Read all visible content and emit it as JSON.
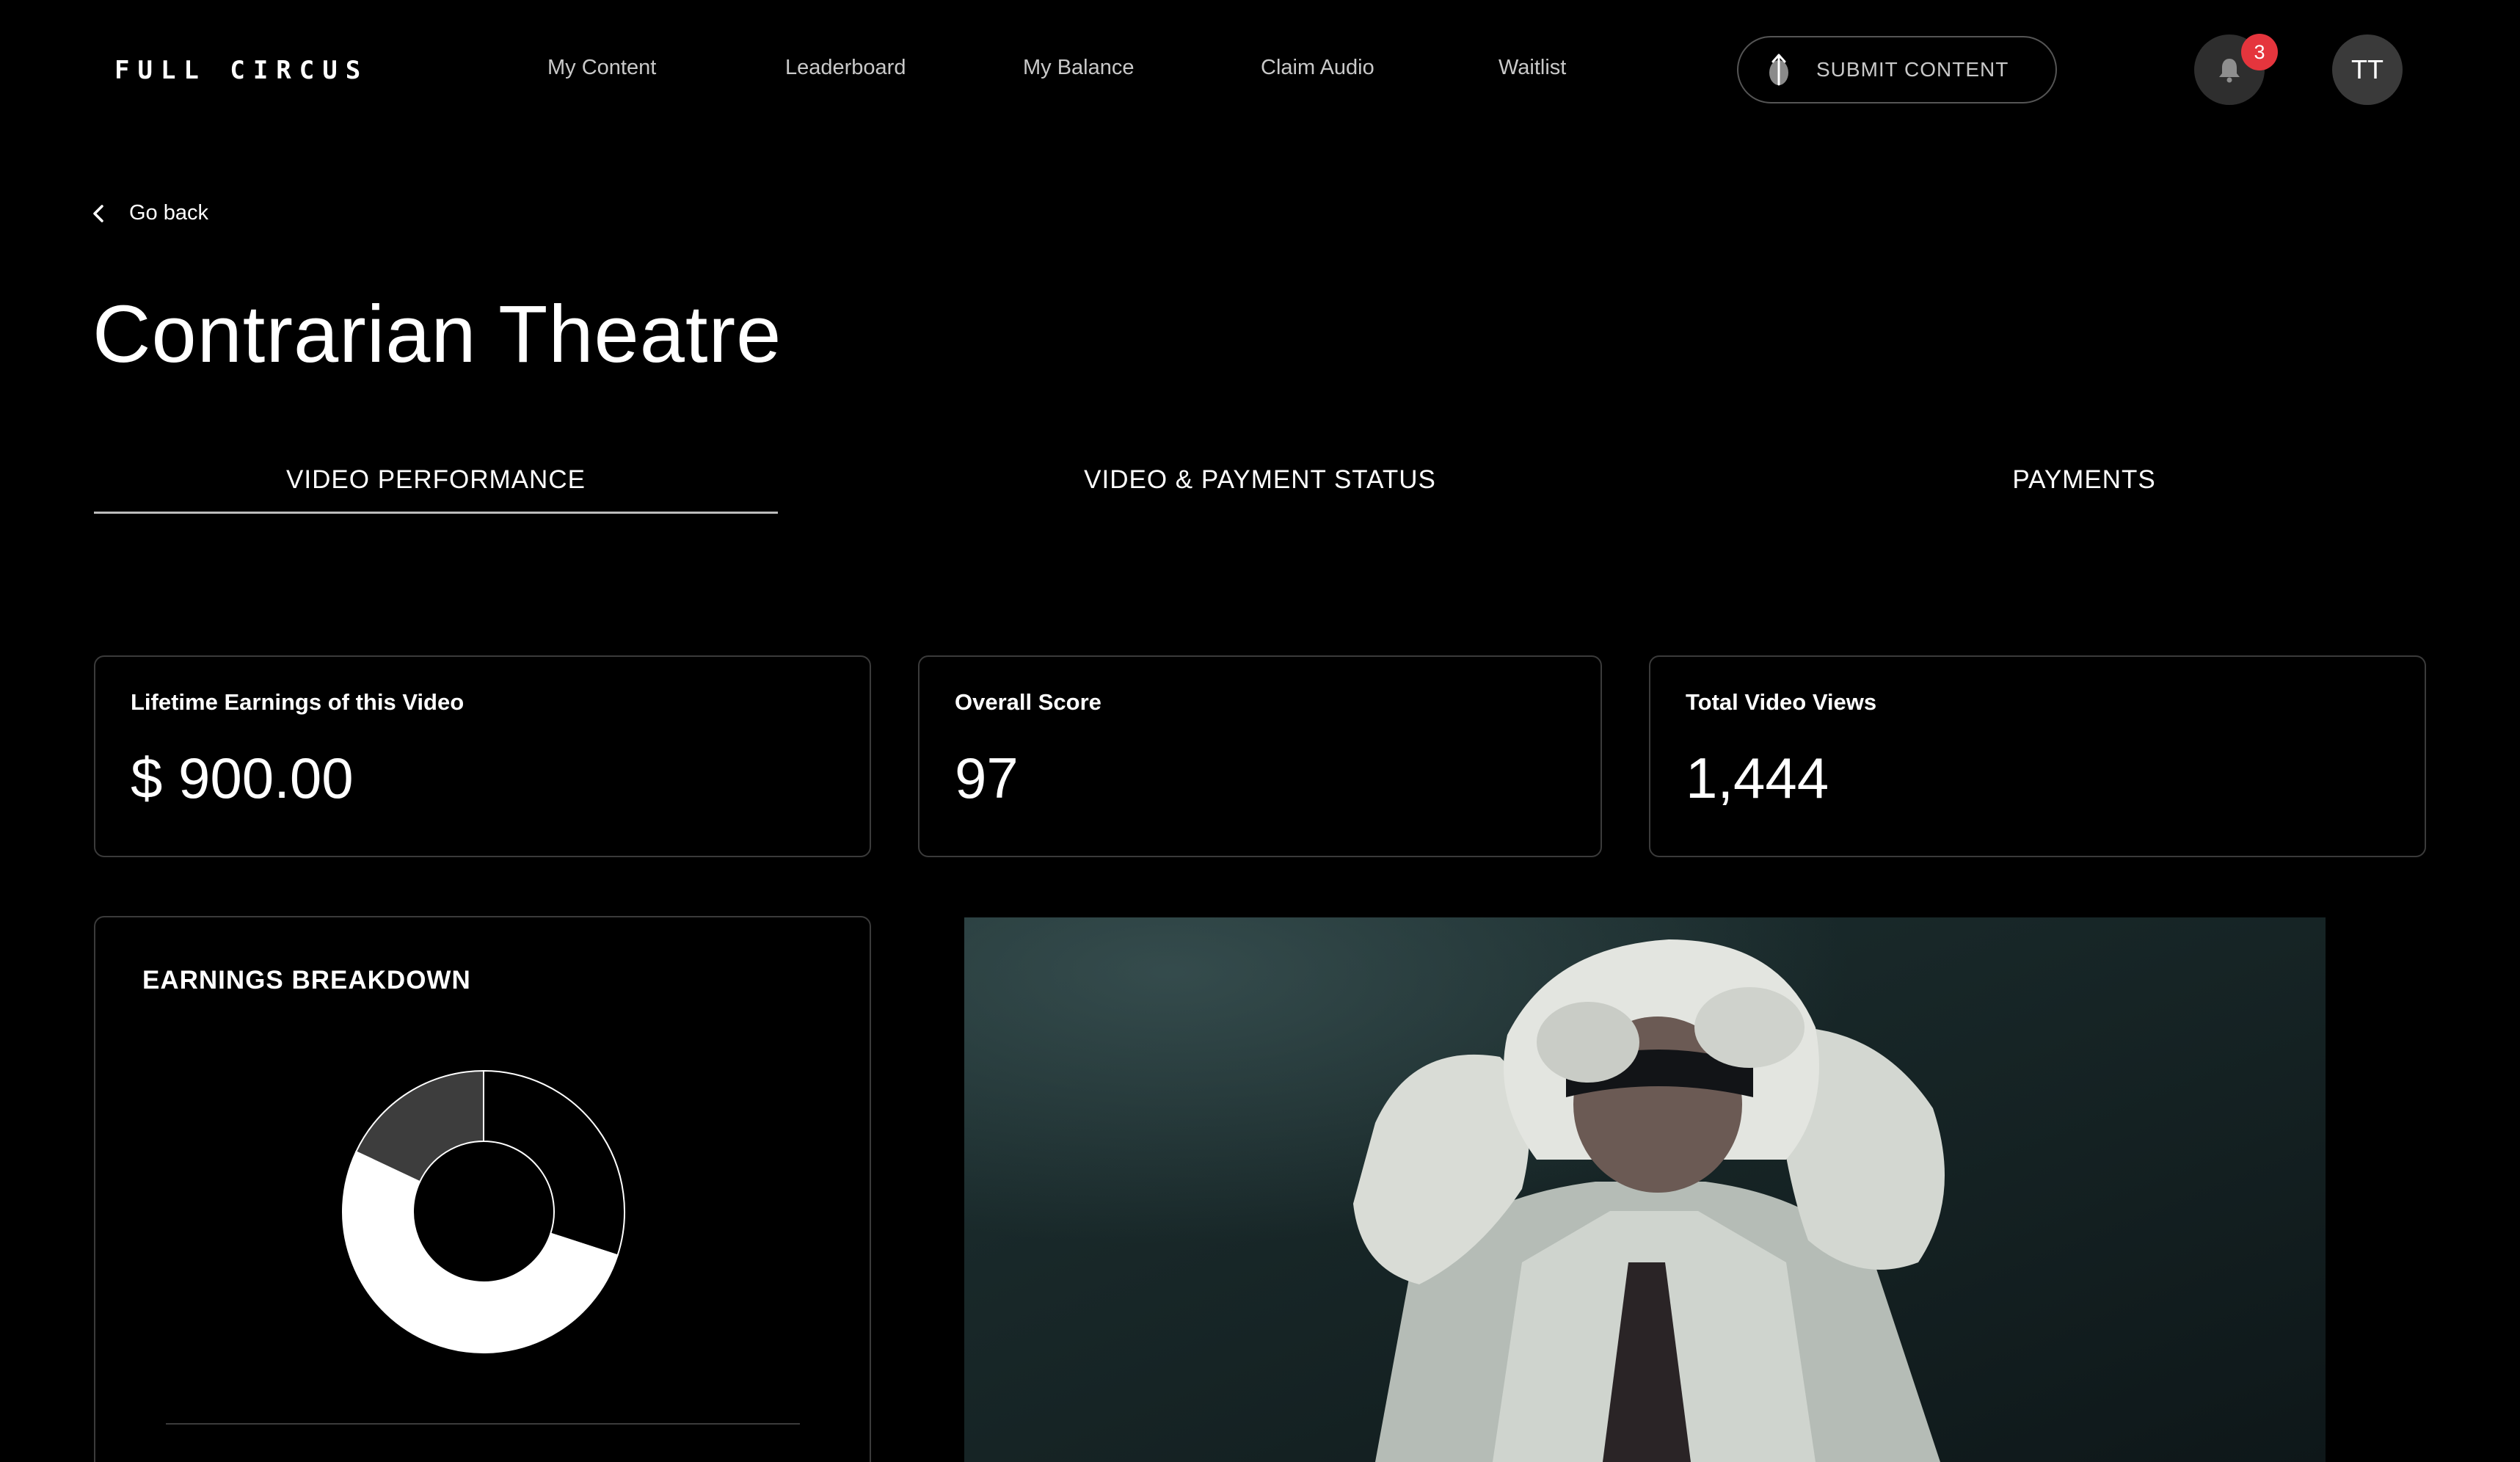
{
  "header": {
    "logo": "FULL CIRCUS",
    "nav": [
      "My Content",
      "Leaderboard",
      "My Balance",
      "Claim Audio",
      "Waitlist"
    ],
    "submit_label": "SUBMIT CONTENT",
    "notification_count": "3",
    "avatar_initials": "TT"
  },
  "back_label": "Go back",
  "title": "Contrarian Theatre",
  "tabs": [
    "VIDEO PERFORMANCE",
    "VIDEO & PAYMENT STATUS",
    "PAYMENTS"
  ],
  "active_tab": "VIDEO PERFORMANCE",
  "stats": [
    {
      "label": "Lifetime Earnings of this Video",
      "value": "$ 900.00"
    },
    {
      "label": "Overall Score",
      "value": "97"
    },
    {
      "label": "Total Video Views",
      "value": "1,444"
    }
  ],
  "earnings": {
    "title": "EARNINGS BREAKDOWN",
    "chart_data": {
      "type": "pie",
      "values": [
        30,
        52,
        18
      ],
      "colors": [
        "#000000",
        "#ffffff",
        "#3d3d3d"
      ]
    }
  },
  "colors": {
    "background": "#000000",
    "card_border": "#3b3b3b",
    "badge": "#e5353d"
  }
}
